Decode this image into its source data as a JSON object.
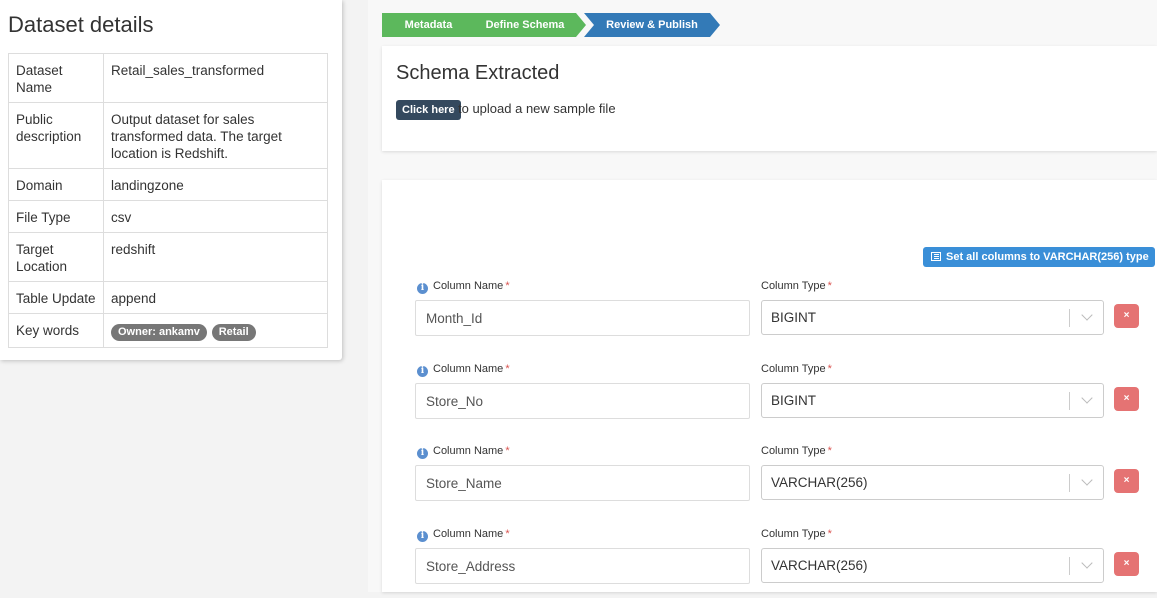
{
  "dataset_details": {
    "title": "Dataset details",
    "rows": [
      {
        "key": "Dataset Name",
        "value": "Retail_sales_transformed"
      },
      {
        "key": "Public description",
        "value": "Output dataset for sales transformed data. The target location is Redshift."
      },
      {
        "key": "Domain",
        "value": "landingzone"
      },
      {
        "key": "File Type",
        "value": "csv"
      },
      {
        "key": "Target Location",
        "value": "redshift"
      },
      {
        "key": "Table Update",
        "value": "append"
      },
      {
        "key": "Key words",
        "badges": [
          "Owner: ankamv",
          "Retail"
        ]
      }
    ]
  },
  "wizard": {
    "steps": [
      {
        "label": "Metadata",
        "state": "done"
      },
      {
        "label": "Define Schema",
        "state": "done"
      },
      {
        "label": "Review & Publish",
        "state": "active"
      }
    ],
    "colors": {
      "done": "#5cb85c",
      "active": "#337ab7"
    }
  },
  "schema": {
    "title": "Schema Extracted",
    "click_here_label": "Click here",
    "upload_text": "to upload a new sample file",
    "set_all_label": "Set all columns to VARCHAR(256) type",
    "column_name_label": "Column Name",
    "column_type_label": "Column Type",
    "required_mark": "*",
    "remove_label": "×",
    "columns": [
      {
        "name": "Month_Id",
        "type": "BIGINT"
      },
      {
        "name": "Store_No",
        "type": "BIGINT"
      },
      {
        "name": "Store_Name",
        "type": "VARCHAR(256)"
      },
      {
        "name": "Store_Address",
        "type": "VARCHAR(256)"
      }
    ]
  }
}
